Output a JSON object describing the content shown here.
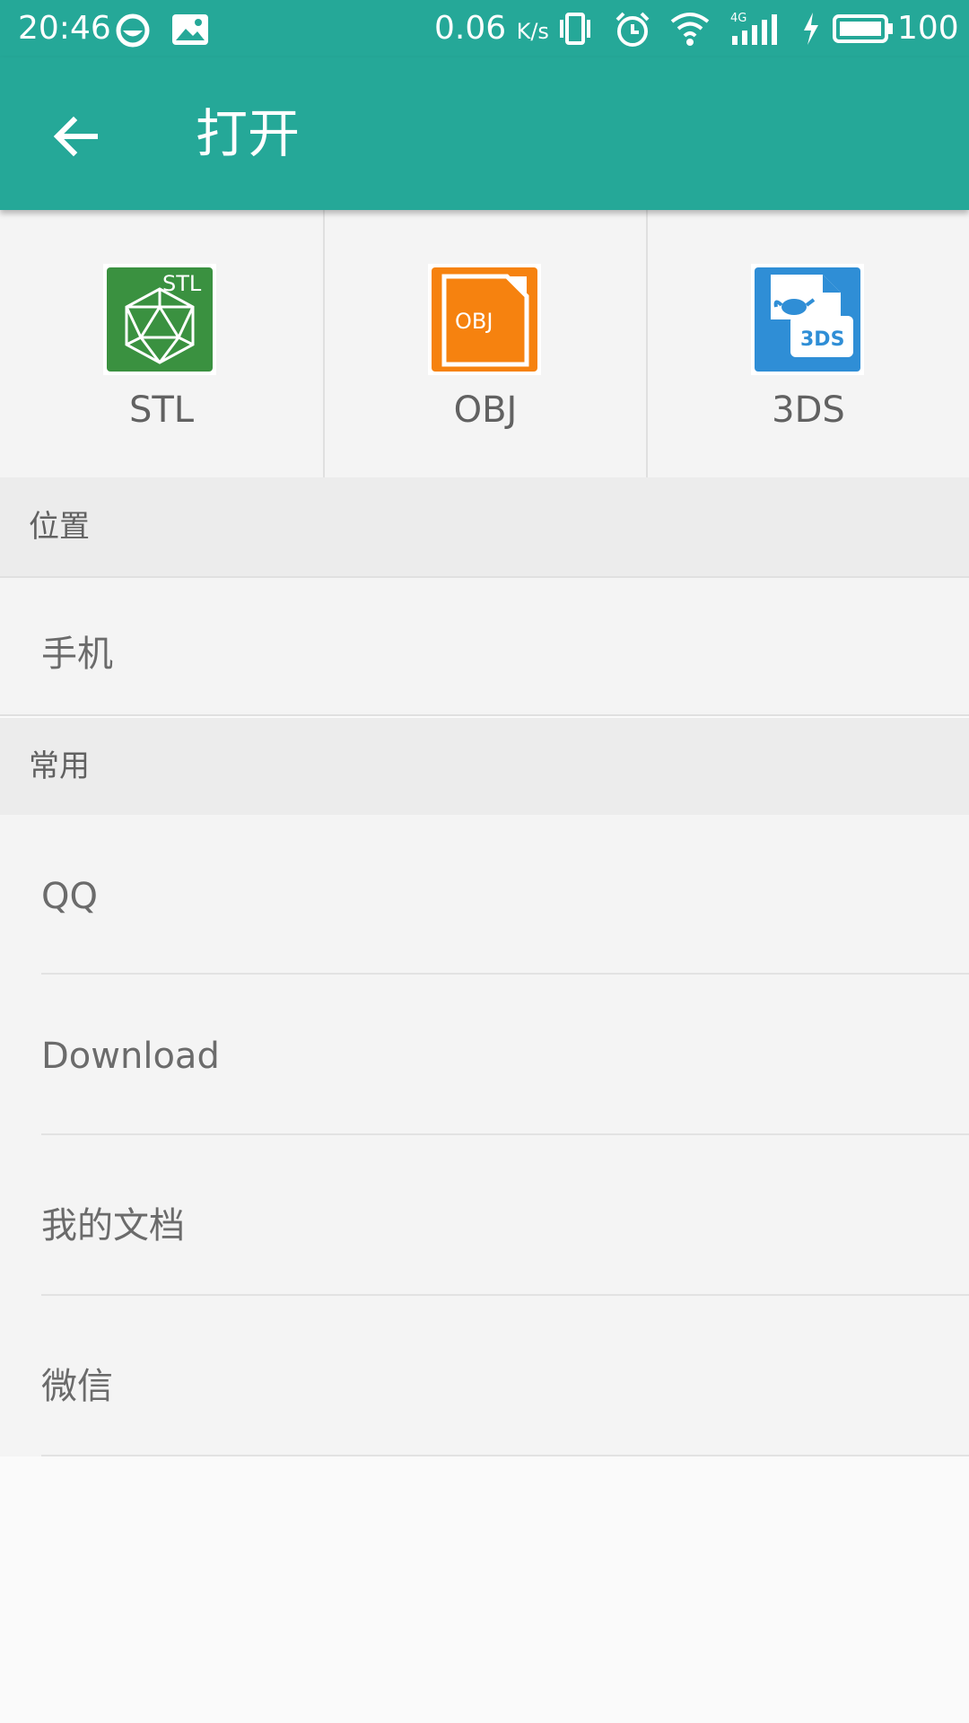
{
  "status_bar": {
    "time": "20:46",
    "net_speed": "0.06",
    "net_unit": "K/s",
    "network": "4G",
    "battery": "100"
  },
  "app_bar": {
    "title": "打开",
    "back_icon": "arrow-back-icon"
  },
  "file_types": [
    {
      "label": "STL",
      "icon_text": "STL",
      "color": "#3a9140"
    },
    {
      "label": "OBJ",
      "icon_text": "OBJ",
      "color": "#f6820f"
    },
    {
      "label": "3DS",
      "icon_text": "3DS",
      "color": "#2f8ed6"
    }
  ],
  "sections": {
    "location": {
      "header": "位置",
      "items": [
        {
          "label": "手机"
        }
      ]
    },
    "common": {
      "header": "常用",
      "items": [
        {
          "label": "QQ"
        },
        {
          "label": "Download"
        },
        {
          "label": "我的文档"
        },
        {
          "label": "微信"
        }
      ]
    }
  },
  "colors": {
    "accent": "#25a898"
  }
}
